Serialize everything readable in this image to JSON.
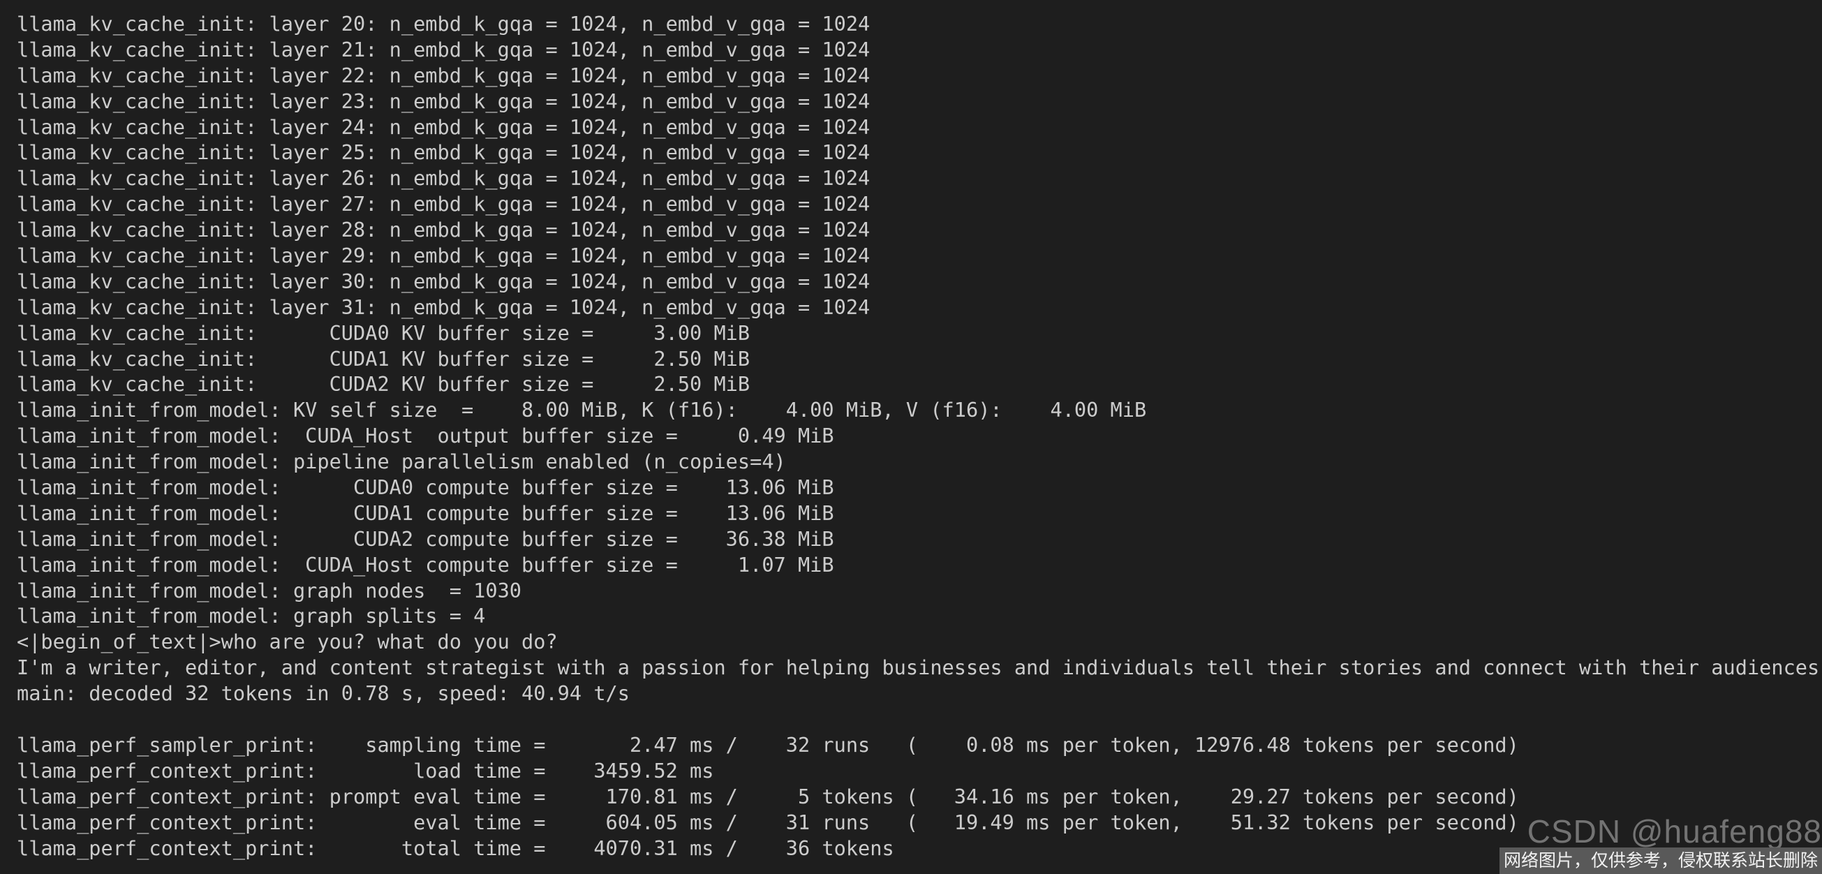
{
  "terminal": {
    "lines": [
      "llama_kv_cache_init: layer 20: n_embd_k_gqa = 1024, n_embd_v_gqa = 1024",
      "llama_kv_cache_init: layer 21: n_embd_k_gqa = 1024, n_embd_v_gqa = 1024",
      "llama_kv_cache_init: layer 22: n_embd_k_gqa = 1024, n_embd_v_gqa = 1024",
      "llama_kv_cache_init: layer 23: n_embd_k_gqa = 1024, n_embd_v_gqa = 1024",
      "llama_kv_cache_init: layer 24: n_embd_k_gqa = 1024, n_embd_v_gqa = 1024",
      "llama_kv_cache_init: layer 25: n_embd_k_gqa = 1024, n_embd_v_gqa = 1024",
      "llama_kv_cache_init: layer 26: n_embd_k_gqa = 1024, n_embd_v_gqa = 1024",
      "llama_kv_cache_init: layer 27: n_embd_k_gqa = 1024, n_embd_v_gqa = 1024",
      "llama_kv_cache_init: layer 28: n_embd_k_gqa = 1024, n_embd_v_gqa = 1024",
      "llama_kv_cache_init: layer 29: n_embd_k_gqa = 1024, n_embd_v_gqa = 1024",
      "llama_kv_cache_init: layer 30: n_embd_k_gqa = 1024, n_embd_v_gqa = 1024",
      "llama_kv_cache_init: layer 31: n_embd_k_gqa = 1024, n_embd_v_gqa = 1024",
      "llama_kv_cache_init:      CUDA0 KV buffer size =     3.00 MiB",
      "llama_kv_cache_init:      CUDA1 KV buffer size =     2.50 MiB",
      "llama_kv_cache_init:      CUDA2 KV buffer size =     2.50 MiB",
      "llama_init_from_model: KV self size  =    8.00 MiB, K (f16):    4.00 MiB, V (f16):    4.00 MiB",
      "llama_init_from_model:  CUDA_Host  output buffer size =     0.49 MiB",
      "llama_init_from_model: pipeline parallelism enabled (n_copies=4)",
      "llama_init_from_model:      CUDA0 compute buffer size =    13.06 MiB",
      "llama_init_from_model:      CUDA1 compute buffer size =    13.06 MiB",
      "llama_init_from_model:      CUDA2 compute buffer size =    36.38 MiB",
      "llama_init_from_model:  CUDA_Host compute buffer size =     1.07 MiB",
      "llama_init_from_model: graph nodes  = 1030",
      "llama_init_from_model: graph splits = 4",
      "<|begin_of_text|>who are you? what do you do?",
      "I'm a writer, editor, and content strategist with a passion for helping businesses and individuals tell their stories and connect with their audiences.",
      "main: decoded 32 tokens in 0.78 s, speed: 40.94 t/s",
      "",
      "llama_perf_sampler_print:    sampling time =       2.47 ms /    32 runs   (    0.08 ms per token, 12976.48 tokens per second)",
      "llama_perf_context_print:        load time =    3459.52 ms",
      "llama_perf_context_print: prompt eval time =     170.81 ms /     5 tokens (   34.16 ms per token,    29.27 tokens per second)",
      "llama_perf_context_print:        eval time =     604.05 ms /    31 runs   (   19.49 ms per token,    51.32 tokens per second)",
      "llama_perf_context_print:       total time =    4070.31 ms /    36 tokens"
    ]
  },
  "watermark": {
    "text": "CSDN @huafeng88",
    "notice": "网络图片，仅供参考，侵权联系站长删除"
  },
  "colors": {
    "background": "#1e1e1e",
    "text": "#cccccc"
  }
}
